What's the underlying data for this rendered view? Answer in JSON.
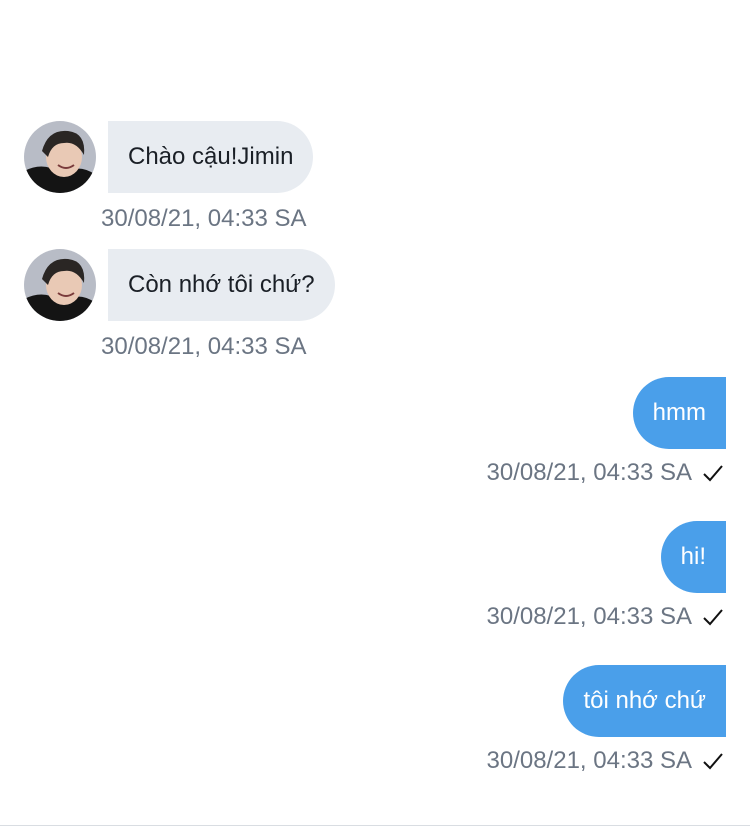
{
  "messages": [
    {
      "direction": "in",
      "text": "Chào cậu!Jimin",
      "time": "30/08/21, 04:33 SA",
      "avatar": "user-photo"
    },
    {
      "direction": "in",
      "text": "Còn nhớ tôi chứ?",
      "time": "30/08/21, 04:33 SA",
      "avatar": "user-photo"
    },
    {
      "direction": "out",
      "text": "hmm",
      "time": "30/08/21, 04:33 SA",
      "status_icon": "check-icon"
    },
    {
      "direction": "out",
      "text": "hi!",
      "time": "30/08/21, 04:33 SA",
      "status_icon": "check-icon"
    },
    {
      "direction": "out",
      "text": "tôi nhớ chứ",
      "time": "30/08/21, 04:33 SA",
      "status_icon": "check-icon"
    }
  ],
  "colors": {
    "incoming_bubble": "#e8ecf1",
    "outgoing_bubble": "#4a9fea",
    "timestamp": "#6b7583"
  }
}
